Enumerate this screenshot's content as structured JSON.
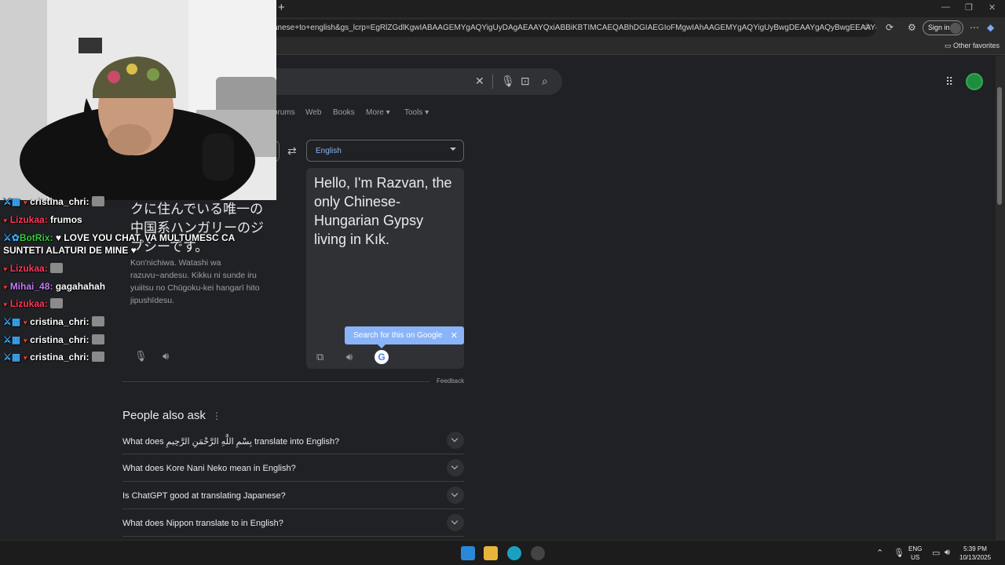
{
  "browser": {
    "url": "anese+to+english&gs_lcrp=EgRlZGdlKgwIABAAGEMYgAQYigUyDAgAEAAYQxiABBiKBTIMCAEQABhDGIAEGIoFMgwIAhAAGEMYgAQYigUyBwgDEAAYgAQyBwgEEAAYgAQyBwgFEAA...",
    "sign_in": "Sign in",
    "other_favorites": "Other favorites"
  },
  "tabs": [
    "orums",
    "Web",
    "Books",
    "More",
    "Tools"
  ],
  "translate": {
    "target_lang": "English",
    "source_text": "クに住んでいる唯一の中国系ハンガリーのジプシーです。",
    "romanization": "Kon'nichiwa. Watashi wa razuvu~andesu. Kikku ni sunde iru yuiitsu no Chūgoku-kei hangarī hito jipushīdesu.",
    "translated_text": "Hello, I'm Razvan, the only Chinese-Hungarian Gypsy living in Kık.",
    "tooltip": "Search for this on Google",
    "feedback": "Feedback"
  },
  "paa": {
    "title": "People also ask",
    "questions": [
      "What does بِسْمِ اللَّهِ الرَّحْمَنِ الرَّحِيمِ translate into English?",
      "What does Kore Nani Neko mean in English?",
      "Is ChatGPT good at translating Japanese?",
      "What does Nippon translate to in English?"
    ]
  },
  "chat": [
    {
      "user": "cristina_chri:",
      "user_color": "#ffffff",
      "text": ""
    },
    {
      "user": "Lizukaa:",
      "user_color": "#ff3b5c",
      "text": "frumos"
    },
    {
      "user": "BotRix:",
      "user_color": "#35d03a",
      "text": "LOVE YOU CHAT, VA MULTUMESC CA"
    },
    {
      "user": "",
      "user_color": "#ffffff",
      "text": "SUNTETI ALATURI DE MINE"
    },
    {
      "user": "Lizukaa:",
      "user_color": "#ff3b5c",
      "text": ""
    },
    {
      "user": "Mihai_48:",
      "user_color": "#c77dff",
      "text": "gagahahah"
    },
    {
      "user": "Lizukaa:",
      "user_color": "#ff3b5c",
      "text": ""
    },
    {
      "user": "cristina_chri:",
      "user_color": "#ffffff",
      "text": ""
    },
    {
      "user": "cristina_chri:",
      "user_color": "#ffffff",
      "text": ""
    },
    {
      "user": "cristina_chri:",
      "user_color": "#ffffff",
      "text": ""
    }
  ],
  "system": {
    "lang1": "ENG",
    "lang2": "US",
    "time": "5:39 PM",
    "date": "10/13/2025"
  }
}
